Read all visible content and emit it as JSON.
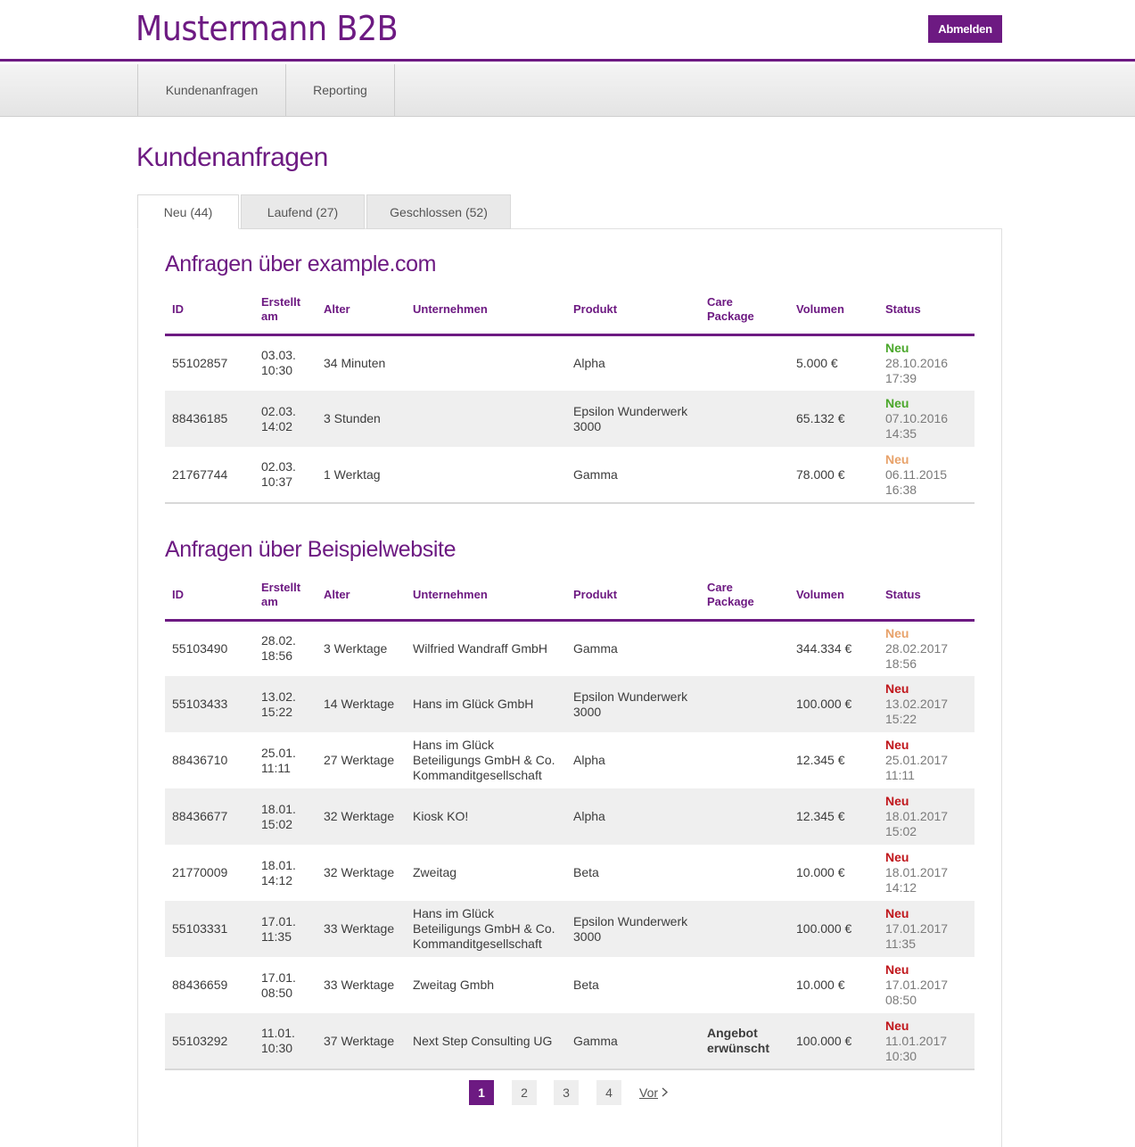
{
  "header": {
    "logo": "Mustermann B2B",
    "logout_label": "Abmelden"
  },
  "nav": {
    "items": [
      {
        "label": "Kundenanfragen"
      },
      {
        "label": "Reporting"
      }
    ]
  },
  "page_title": "Kundenanfragen",
  "tabs": [
    {
      "label": "Neu (44)"
    },
    {
      "label": "Laufend (27)"
    },
    {
      "label": "Geschlossen (52)"
    }
  ],
  "columns": {
    "id": "ID",
    "created": "Erstellt am",
    "age": "Alter",
    "company": "Unternehmen",
    "product": "Produkt",
    "care": "Care Package",
    "volume": "Volumen",
    "status": "Status"
  },
  "sections": [
    {
      "title": "Anfragen über example.com",
      "rows": [
        {
          "id": "55102857",
          "created_date": "03.03.",
          "created_time": "10:30",
          "age": "34 Minuten",
          "age_color": "green",
          "company": "",
          "product": "Alpha",
          "care": "",
          "volume": "5.000 €",
          "status": "Neu",
          "status_color": "green",
          "status_date": "28.10.2016",
          "status_time": "17:39"
        },
        {
          "id": "88436185",
          "created_date": "02.03.",
          "created_time": "14:02",
          "age": "3 Stunden",
          "age_color": "green",
          "company": "",
          "product": "Epsilon Wunderwerk 3000",
          "care": "",
          "volume": "65.132 €",
          "status": "Neu",
          "status_color": "green",
          "status_date": "07.10.2016",
          "status_time": "14:35"
        },
        {
          "id": "21767744",
          "created_date": "02.03.",
          "created_time": "10:37",
          "age": "1 Werktag",
          "age_color": "orange",
          "company": "",
          "product": "Gamma",
          "care": "",
          "volume": "78.000 €",
          "status": "Neu",
          "status_color": "orange",
          "status_date": "06.11.2015",
          "status_time": "16:38"
        }
      ]
    },
    {
      "title": "Anfragen über Beispielwebsite",
      "rows": [
        {
          "id": "55103490",
          "created_date": "28.02.",
          "created_time": "18:56",
          "age": "3 Werktage",
          "age_color": "orange",
          "company": "Wilfried Wandraff GmbH",
          "product": "Gamma",
          "care": "",
          "volume": "344.334 €",
          "status": "Neu",
          "status_color": "orange",
          "status_date": "28.02.2017",
          "status_time": "18:56"
        },
        {
          "id": "55103433",
          "created_date": "13.02.",
          "created_time": "15:22",
          "age": "14 Werktage",
          "age_color": "red",
          "company": "Hans im Glück GmbH",
          "product": "Epsilon Wunderwerk 3000",
          "care": "",
          "volume": "100.000 €",
          "status": "Neu",
          "status_color": "red",
          "status_date": "13.02.2017",
          "status_time": "15:22"
        },
        {
          "id": "88436710",
          "created_date": "25.01.",
          "created_time": "11:11",
          "age": "27 Werktage",
          "age_color": "red",
          "company": "Hans im Glück Beteiligungs GmbH & Co. Kommanditgesellschaft",
          "product": "Alpha",
          "care": "",
          "volume": "12.345 €",
          "status": "Neu",
          "status_color": "red",
          "status_date": "25.01.2017",
          "status_time": "11:11"
        },
        {
          "id": "88436677",
          "created_date": "18.01.",
          "created_time": "15:02",
          "age": "32 Werktage",
          "age_color": "red",
          "company": "Kiosk KO!",
          "product": "Alpha",
          "care": "",
          "volume": "12.345 €",
          "status": "Neu",
          "status_color": "red",
          "status_date": "18.01.2017",
          "status_time": "15:02"
        },
        {
          "id": "21770009",
          "created_date": "18.01.",
          "created_time": "14:12",
          "age": "32 Werktage",
          "age_color": "red",
          "company": "Zweitag",
          "product": "Beta",
          "care": "",
          "volume": "10.000 €",
          "status": "Neu",
          "status_color": "red",
          "status_date": "18.01.2017",
          "status_time": "14:12"
        },
        {
          "id": "55103331",
          "created_date": "17.01.",
          "created_time": "11:35",
          "age": "33 Werktage",
          "age_color": "red",
          "company": "Hans im Glück Beteiligungs GmbH & Co. Kommanditgesellschaft",
          "product": "Epsilon Wunderwerk 3000",
          "care": "",
          "volume": "100.000 €",
          "status": "Neu",
          "status_color": "red",
          "status_date": "17.01.2017",
          "status_time": "11:35"
        },
        {
          "id": "88436659",
          "created_date": "17.01.",
          "created_time": "08:50",
          "age": "33 Werktage",
          "age_color": "red",
          "company": "Zweitag Gmbh",
          "product": "Beta",
          "care": "",
          "volume": "10.000 €",
          "status": "Neu",
          "status_color": "red",
          "status_date": "17.01.2017",
          "status_time": "08:50"
        },
        {
          "id": "55103292",
          "created_date": "11.01.",
          "created_time": "10:30",
          "age": "37 Werktage",
          "age_color": "red",
          "company": "Next Step Consulting UG",
          "product": "Gamma",
          "care": "Angebot erwünscht",
          "volume": "100.000 €",
          "status": "Neu",
          "status_color": "red",
          "status_date": "11.01.2017",
          "status_time": "10:30"
        }
      ]
    }
  ],
  "pagination": {
    "pages": [
      "1",
      "2",
      "3",
      "4"
    ],
    "current": "1",
    "next_label": "Vor",
    "next_icon": "chevron-right-icon"
  },
  "colors": {
    "brand": "#6d1a82",
    "green": "#4aa72a",
    "orange": "#e8a26a",
    "red": "#c0161b"
  }
}
